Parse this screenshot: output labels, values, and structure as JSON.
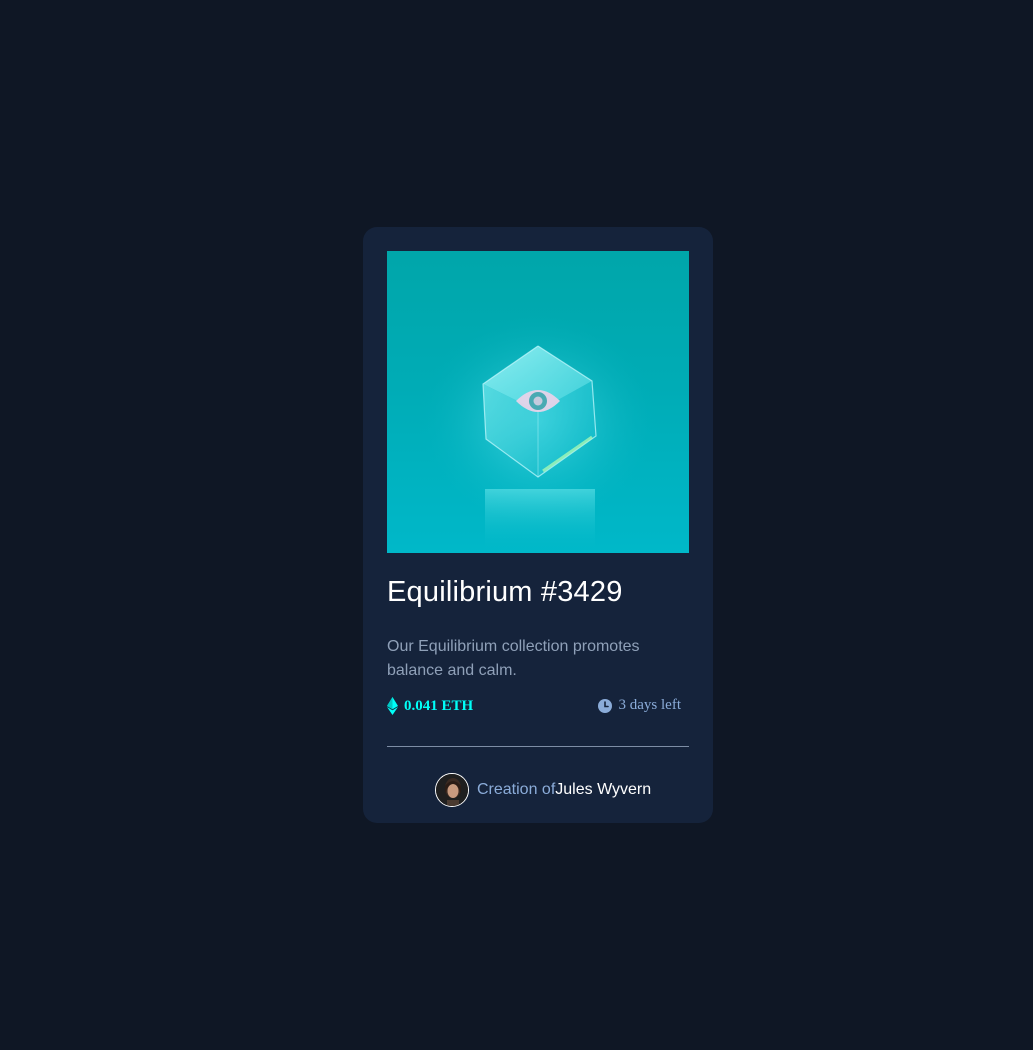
{
  "card": {
    "image_alt": "Equilibrium cube image",
    "title": "Equilibrium #3429",
    "description": "Our Equilibrium collection promotes balance and calm.",
    "price": "0.041 ETH",
    "time_left": "3 days left",
    "creator_prefix": "Creation of",
    "creator_name": "Jules Wyvern"
  },
  "icons": {
    "price": "ethereum-icon",
    "time": "clock-icon",
    "hero_overlay": "eye-icon"
  },
  "colors": {
    "background": "#0f1725",
    "card": "#15233b",
    "cyan": "#00fff8",
    "soft_blue": "#8bacd9",
    "white": "#ffffff"
  }
}
